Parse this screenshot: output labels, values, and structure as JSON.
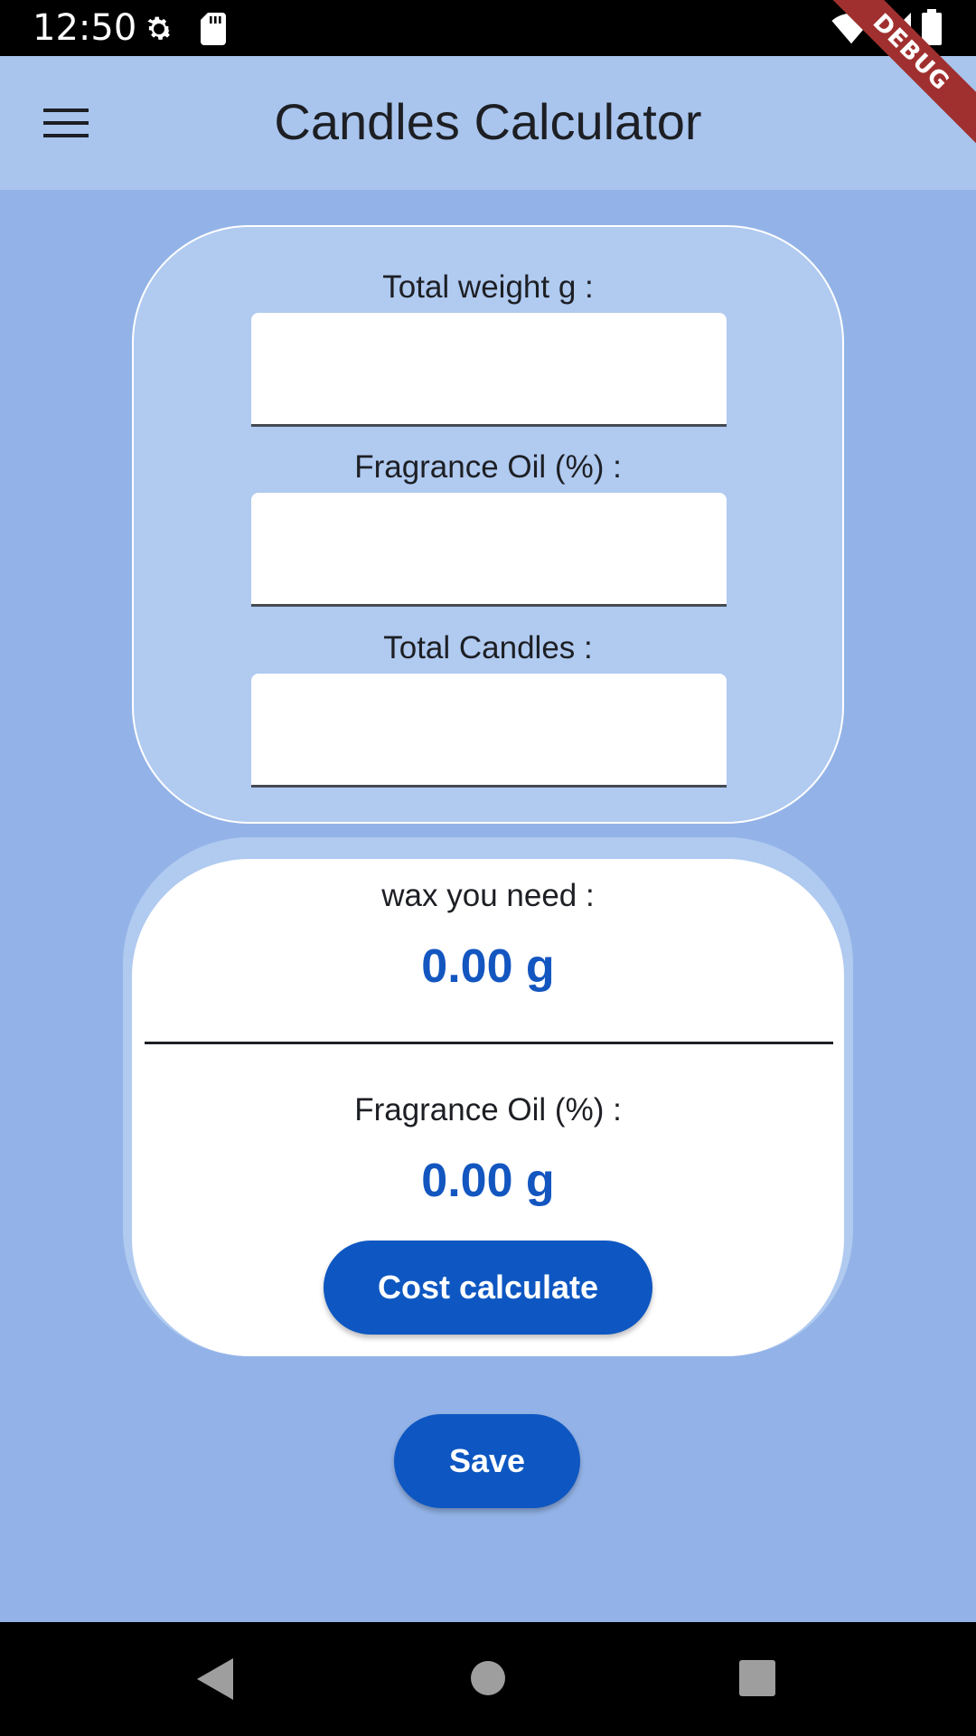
{
  "status_bar": {
    "time": "12:50",
    "icons": [
      "gear-icon",
      "sd-card-icon",
      "wifi-icon",
      "signal-icon",
      "battery-icon"
    ],
    "debug_label": "DEBUG"
  },
  "app_bar": {
    "title": "Candles Calculator",
    "menu_icon": "hamburger-menu-icon"
  },
  "inputs": {
    "total_weight": {
      "label": "Total weight g :",
      "value": "",
      "placeholder": ""
    },
    "fragrance_oil": {
      "label": "Fragrance Oil (%)  :",
      "value": "",
      "placeholder": ""
    },
    "total_candles": {
      "label": "Total Candles :",
      "value": "",
      "placeholder": ""
    }
  },
  "results": {
    "wax_label": "wax you need :",
    "wax_value": "0.00 g",
    "fragrance_label": "Fragrance Oil (%)  :",
    "fragrance_value": "0.00 g",
    "cost_button_label": "Cost calculate"
  },
  "actions": {
    "save_label": "Save"
  },
  "nav_bar": {
    "icons": [
      "back-icon",
      "home-icon",
      "recents-icon"
    ]
  },
  "colors": {
    "background": "#93b3e8",
    "app_bar": "#a9c5ee",
    "card": "#b0caf0",
    "accent": "#0e57c2",
    "value_text": "#1356c0"
  }
}
